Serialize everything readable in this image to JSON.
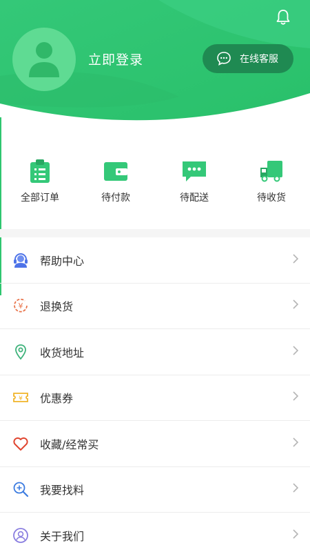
{
  "header": {
    "login_label": "立即登录",
    "service_label": "在线客服",
    "accent_color": "#2fc66f"
  },
  "orders": [
    {
      "label": "全部订单",
      "icon": "clipboard-icon"
    },
    {
      "label": "待付款",
      "icon": "wallet-icon"
    },
    {
      "label": "待配送",
      "icon": "chat-dots-icon"
    },
    {
      "label": "待收货",
      "icon": "truck-icon"
    }
  ],
  "menu": [
    {
      "label": "帮助中心",
      "icon": "headset-icon"
    },
    {
      "label": "退换货",
      "icon": "yuan-exchange-icon"
    },
    {
      "label": "收货地址",
      "icon": "location-pin-icon"
    },
    {
      "label": "优惠券",
      "icon": "coupon-icon"
    },
    {
      "label": "收藏/经常买",
      "icon": "heart-icon"
    },
    {
      "label": "我要找料",
      "icon": "zoom-search-icon"
    },
    {
      "label": "关于我们",
      "icon": "user-circle-icon"
    }
  ]
}
